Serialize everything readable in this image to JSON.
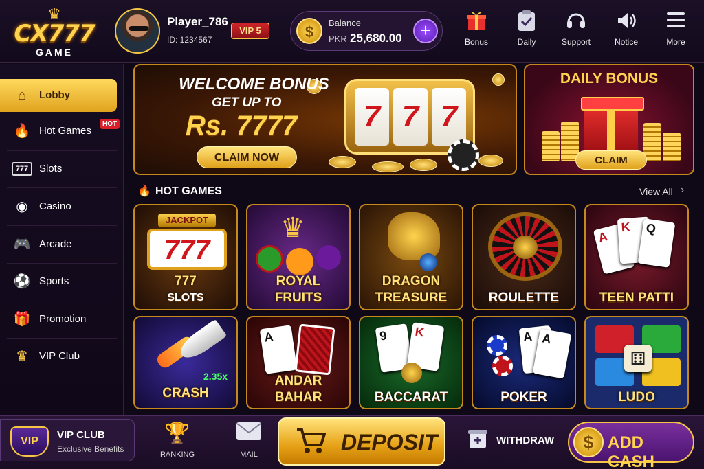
{
  "brand": {
    "logo_line1": "CX777",
    "logo_line2": "GAME"
  },
  "player": {
    "name": "Player_786",
    "id": "ID: 1234567",
    "vip": "VIP 5"
  },
  "balance": {
    "label": "Balance",
    "currency": "PKR",
    "amount": "25,680.00"
  },
  "header_nav": [
    {
      "label": "Bonus",
      "icon": "gift-icon"
    },
    {
      "label": "Daily",
      "icon": "clipboard-check-icon"
    },
    {
      "label": "Support",
      "icon": "headset-icon"
    },
    {
      "label": "Notice",
      "icon": "speaker-icon"
    },
    {
      "label": "More",
      "icon": "menu-icon"
    }
  ],
  "sidebar": {
    "items": [
      {
        "label": "Lobby",
        "icon": "home-icon",
        "active": true
      },
      {
        "label": "Hot Games",
        "icon": "fire-icon",
        "tag": "HOT"
      },
      {
        "label": "Slots",
        "icon": "slot-777-icon"
      },
      {
        "label": "Casino",
        "icon": "chip-icon"
      },
      {
        "label": "Arcade",
        "icon": "gamepad-icon"
      },
      {
        "label": "Sports",
        "icon": "soccer-ball-icon"
      },
      {
        "label": "Promotion",
        "icon": "gift-icon"
      },
      {
        "label": "VIP Club",
        "icon": "vip-crown-icon"
      }
    ]
  },
  "welcome_banner": {
    "title": "WELCOME BONUS",
    "subtitle": "GET UP TO",
    "amount": "Rs. 7777",
    "button": "CLAIM NOW",
    "reel_symbol": "7"
  },
  "daily_banner": {
    "title": "DAILY BONUS",
    "button": "CLAIM"
  },
  "hot_games": {
    "title": "HOT GAMES",
    "view_all": "View All",
    "row1": [
      {
        "line1": "777",
        "line2": "SLOTS",
        "badge": "JACKPOT"
      },
      {
        "line1": "ROYAL",
        "line2": "FRUITS"
      },
      {
        "line1": "DRAGON",
        "line2": "TREASURE"
      },
      {
        "line1": "",
        "line2": "ROULETTE"
      },
      {
        "line1": "",
        "line2": "TEEN PATTI"
      }
    ],
    "row2": [
      {
        "line1": "",
        "line2": "CRASH",
        "multiplier": "2.35x"
      },
      {
        "line1": "ANDAR",
        "line2": "BAHAR"
      },
      {
        "line1": "",
        "line2": "BACCARAT"
      },
      {
        "line1": "",
        "line2": "POKER"
      },
      {
        "line1": "",
        "line2": "LUDO"
      }
    ]
  },
  "cards": {
    "ace": "A",
    "king": "K",
    "queen": "Q",
    "nine": "9"
  },
  "bottom_bar": {
    "vip_club_badge": "VIP",
    "vip_club_title": "VIP CLUB",
    "vip_club_sub": "Exclusive Benefits",
    "ranking": "RANKING",
    "mail": "MAIL",
    "deposit": "DEPOSIT",
    "withdraw": "WITHDRAW",
    "add_cash": "ADD CASH"
  },
  "colors": {
    "gold": "#f6c544",
    "purple_bg": "#1b1026",
    "hot_red": "#d8202a"
  }
}
